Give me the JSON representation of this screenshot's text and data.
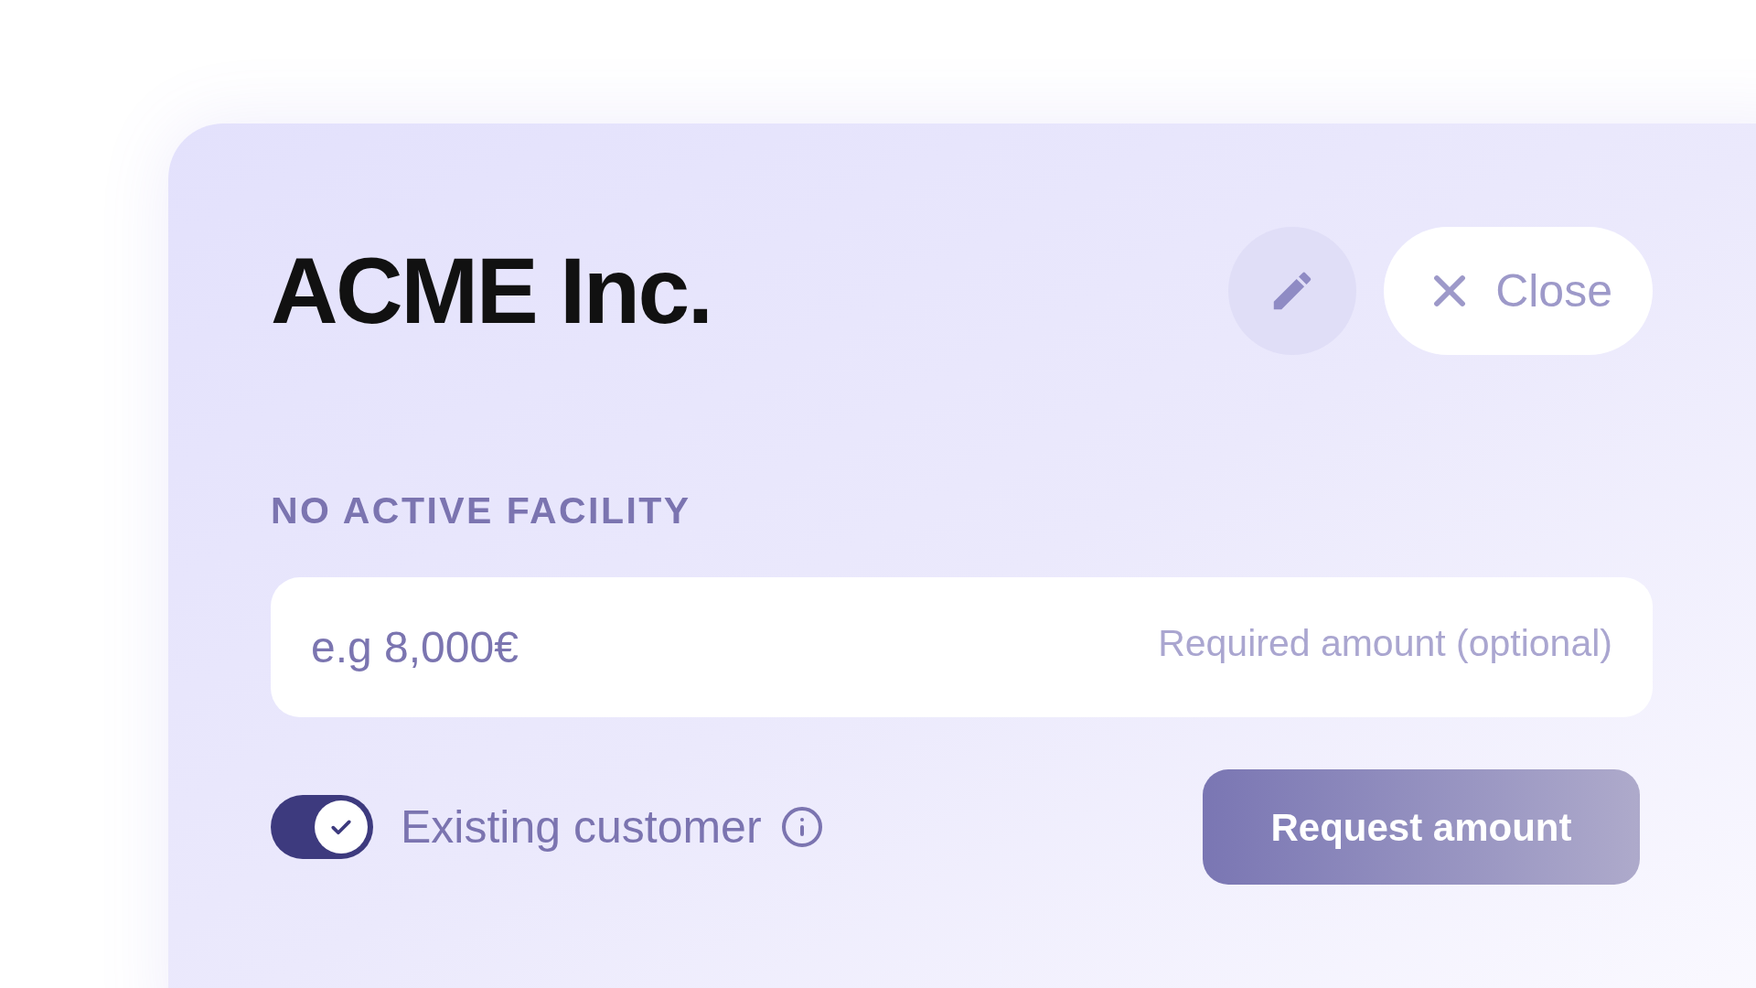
{
  "header": {
    "title": "ACME Inc.",
    "close_button": "Close"
  },
  "facility_status": "NO ACTIVE FACILITY",
  "amount_field": {
    "placeholder": "e.g 8,000€",
    "hint": "Required amount (optional)"
  },
  "existing_customer": {
    "label": "Existing customer",
    "on": true
  },
  "submit_button": "Request amount"
}
